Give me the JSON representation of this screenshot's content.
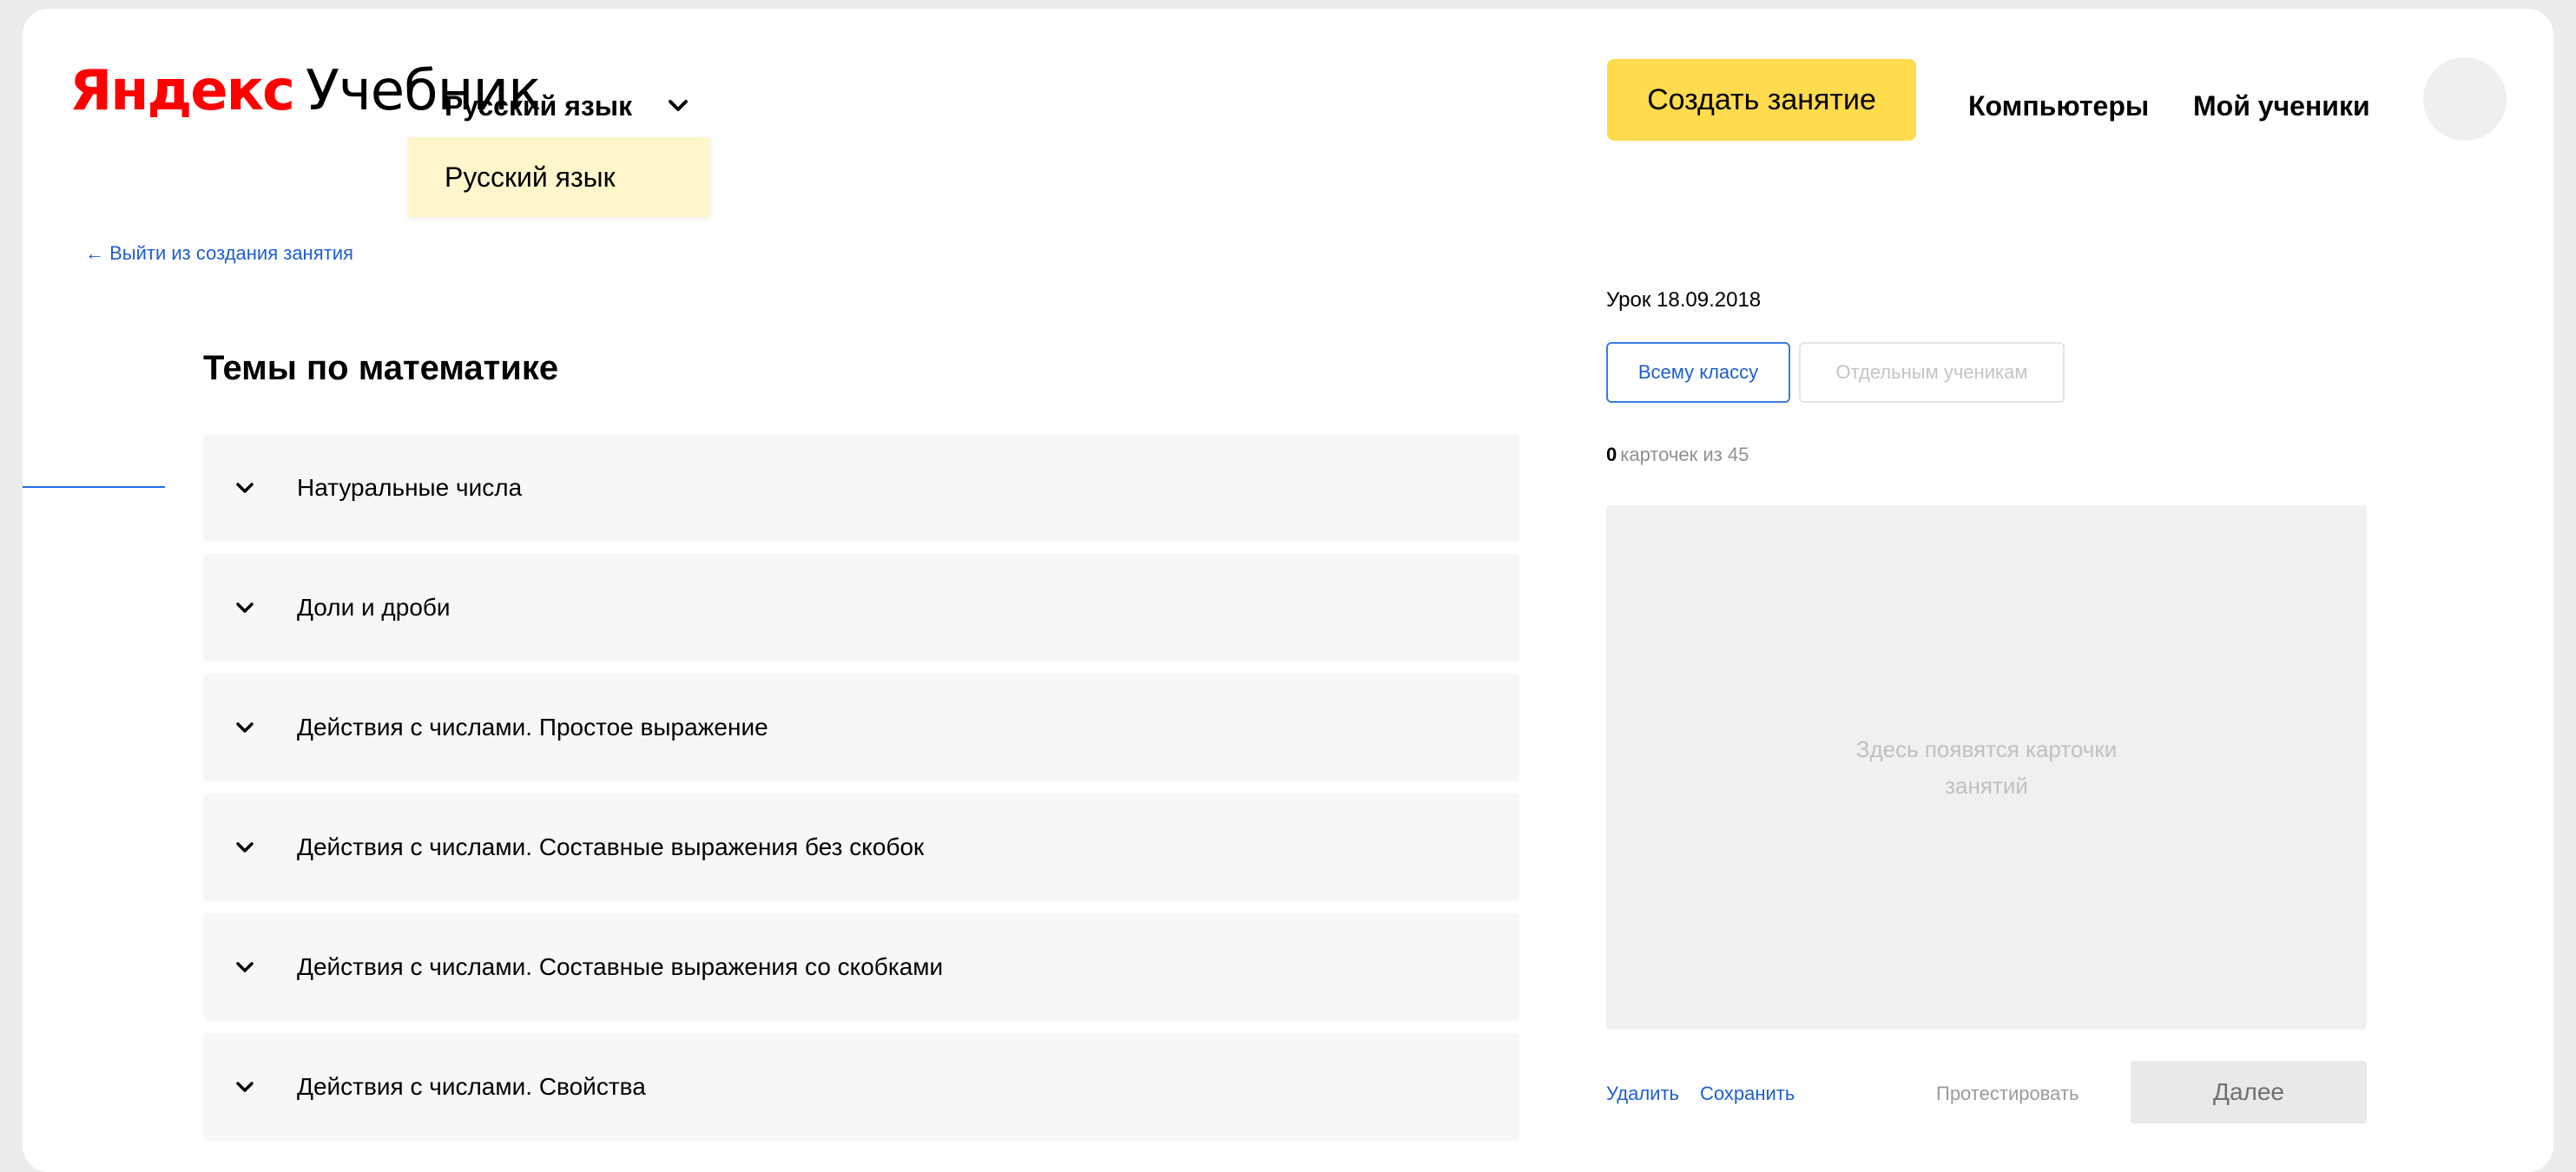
{
  "header": {
    "logo_brand": "Яндекс",
    "logo_product": "Учебник",
    "subject_selected": "Русский язык",
    "subject_dropdown_item": "Русский язык",
    "create_lesson_label": "Создать занятие",
    "nav_computers": "Компьютеры",
    "nav_students": "Мой ученики"
  },
  "left": {
    "exit_link": "← Выйти из создания занятия",
    "topics_title": "Темы по математике",
    "topics": [
      {
        "label": "Натуральные числа"
      },
      {
        "label": "Доли и дроби"
      },
      {
        "label": "Действия с числами. Простое выражение"
      },
      {
        "label": "Действия с числами. Составные выражения без скобок"
      },
      {
        "label": "Действия с числами. Составные выражения со скобками"
      },
      {
        "label": "Действия с числами. Свойства"
      }
    ]
  },
  "right": {
    "lesson_title": "Урок 18.09.2018",
    "seg_all_class": "Всему классу",
    "seg_individual": "Отдельным ученикам",
    "cards_count_value": "0",
    "cards_count_rest": "карточек из 45",
    "cards_placeholder": "Здесь появятся карточки занятий",
    "action_delete": "Удалить",
    "action_save": "Сохранить",
    "action_test": "Протестировать",
    "next_label": "Далее"
  },
  "colors": {
    "accent_yellow": "#ffdb4d",
    "link_blue": "#1e5fcf",
    "logo_red": "#ff0000",
    "dropdown_highlight": "#fff6cc"
  }
}
